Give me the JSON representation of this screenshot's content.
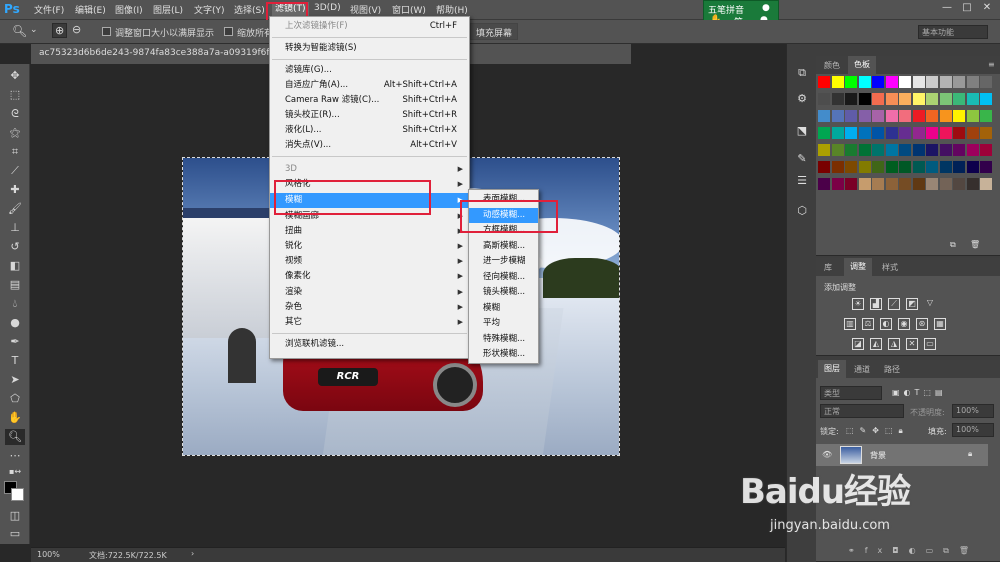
{
  "app": {
    "logo": "Ps"
  },
  "menubar": {
    "items": [
      "文件(F)",
      "编辑(E)",
      "图像(I)",
      "图层(L)",
      "文字(Y)",
      "选择(S)",
      "滤镜(T)",
      "3D(D)",
      "视图(V)",
      "窗口(W)",
      "帮助(H)"
    ]
  },
  "ime": {
    "title": "五笔拼音",
    "sub": "简"
  },
  "workspace": {
    "label": "基本功能"
  },
  "options": {
    "resize_window": "调整窗口大小以满屏显示",
    "zoom_all": "缩放所有窗口",
    "fill_screen": "填充屏幕"
  },
  "document": {
    "tab": "ac75323d6b6de243-9874fa83ce388a7a-a09319f6fe542b...",
    "car_badge": "RCR"
  },
  "status": {
    "zoom": "100%",
    "doc": "文档:722.5K/722.5K"
  },
  "filter_menu": {
    "items": [
      {
        "label": "上次滤镜操作(F)",
        "shortcut": "Ctrl+F",
        "disabled": true
      },
      {
        "label": "转换为智能滤镜(S)",
        "shortcut": ""
      },
      {
        "label": "滤镜库(G)...",
        "shortcut": ""
      },
      {
        "label": "自适应广角(A)...",
        "shortcut": "Alt+Shift+Ctrl+A"
      },
      {
        "label": "Camera Raw 滤镜(C)...",
        "shortcut": "Shift+Ctrl+A"
      },
      {
        "label": "镜头校正(R)...",
        "shortcut": "Shift+Ctrl+R"
      },
      {
        "label": "液化(L)...",
        "shortcut": "Shift+Ctrl+X"
      },
      {
        "label": "消失点(V)...",
        "shortcut": "Alt+Ctrl+V"
      },
      {
        "label": "3D",
        "shortcut": "",
        "disabled": true
      },
      {
        "label": "风格化",
        "shortcut": ""
      },
      {
        "label": "模糊",
        "shortcut": ""
      },
      {
        "label": "模糊画廊",
        "shortcut": ""
      },
      {
        "label": "扭曲",
        "shortcut": ""
      },
      {
        "label": "锐化",
        "shortcut": ""
      },
      {
        "label": "视频",
        "shortcut": ""
      },
      {
        "label": "像素化",
        "shortcut": ""
      },
      {
        "label": "渲染",
        "shortcut": ""
      },
      {
        "label": "杂色",
        "shortcut": ""
      },
      {
        "label": "其它",
        "shortcut": ""
      },
      {
        "label": "浏览联机滤镜...",
        "shortcut": ""
      }
    ]
  },
  "blur_menu": {
    "items": [
      "表面模糊...",
      "动感模糊...",
      "方框模糊...",
      "高斯模糊...",
      "进一步模糊",
      "径向模糊...",
      "镜头模糊...",
      "模糊",
      "平均",
      "特殊模糊...",
      "形状模糊..."
    ]
  },
  "color_panel": {
    "tabs": [
      "颜色",
      "色板"
    ]
  },
  "adjust_panel": {
    "tabs": [
      "库",
      "调整",
      "样式"
    ],
    "title": "添加调整"
  },
  "layers_panel": {
    "tabs": [
      "图层",
      "通道",
      "路径"
    ],
    "kind": "类型",
    "blend": "正常",
    "opacity_label": "不透明度:",
    "opacity": "100%",
    "lock_label": "锁定:",
    "fill_label": "填充:",
    "fill": "100%",
    "layer_name": "背景"
  },
  "watermark": {
    "brand": "Baidu经验",
    "url": "jingyan.baidu.com"
  },
  "swatches": [
    "#ff0000",
    "#ffff00",
    "#00ff00",
    "#00ffff",
    "#0000ff",
    "#ff00ff",
    "#ffffff",
    "#e6e6e6",
    "#cccccc",
    "#b3b3b3",
    "#999999",
    "#808080",
    "#666666",
    "#4d4d4d",
    "#333333",
    "#1a1a1a",
    "#000000",
    "#f26c4f",
    "#f68e56",
    "#fbaf5d",
    "#fff467",
    "#acd372",
    "#7cc576",
    "#3bb878",
    "#1abbb4",
    "#00bff3",
    "#438ccb",
    "#5574b9",
    "#605ca8",
    "#855fa8",
    "#a763a8",
    "#f06ea9",
    "#f26d7d",
    "#ed1c24",
    "#f26522",
    "#f7941d",
    "#fff200",
    "#8dc63f",
    "#39b54a",
    "#00a651",
    "#00a99d",
    "#00aeef",
    "#0072bc",
    "#0054a6",
    "#2e3192",
    "#662d91",
    "#92278f",
    "#ec008c",
    "#ed145b",
    "#9e0b0f",
    "#a0410d",
    "#a36209",
    "#aba000",
    "#598527",
    "#197b30",
    "#007236",
    "#00746b",
    "#0076a3",
    "#004a80",
    "#003471",
    "#1b1464",
    "#440e62",
    "#630460",
    "#9e005d",
    "#9e0039",
    "#790000",
    "#7b2e00",
    "#7d4900",
    "#827b00",
    "#406618",
    "#005e20",
    "#005826",
    "#005952",
    "#005b7f",
    "#003663",
    "#002157",
    "#0d004c",
    "#32004b",
    "#4b0049",
    "#7b0046",
    "#7a0026",
    "#c69c6d",
    "#a67c52",
    "#8c6239",
    "#754c24",
    "#603913",
    "#998675",
    "#736357",
    "#534741",
    "#362f2d",
    "#c7b299"
  ]
}
